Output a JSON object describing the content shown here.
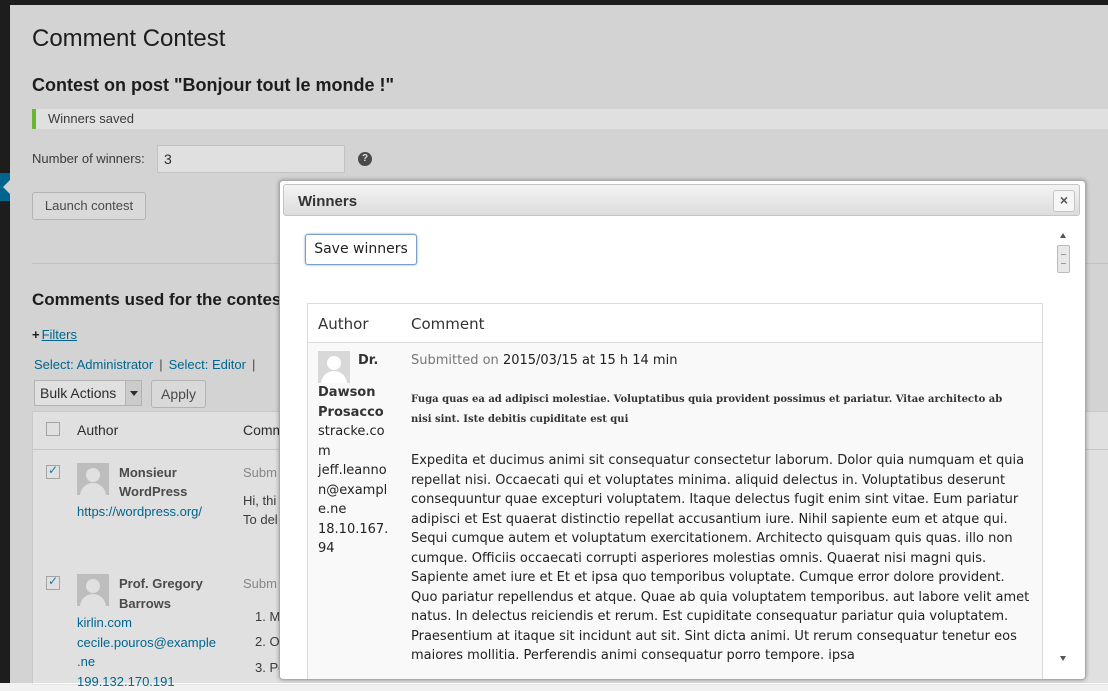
{
  "page": {
    "title": "Comment Contest",
    "subtitle": "Contest on post \"Bonjour tout le monde !\"",
    "notice": "Winners saved",
    "winners_label": "Number of winners:",
    "winners_value": "3",
    "help_icon": "?",
    "launch_button": "Launch contest",
    "comments_heading": "Comments used for the contes",
    "filters_plus": "+",
    "filters_link": "Filters",
    "select_admin": "Select: Administrator",
    "select_editor": "Select: Editor",
    "separator": "|",
    "bulk_actions": "Bulk Actions",
    "apply_button": "Apply"
  },
  "table": {
    "col_author": "Author",
    "col_comment": "Comm",
    "rows": [
      {
        "checked": true,
        "name_line1": "Monsieur",
        "name_line2": "WordPress",
        "url": "https://wordpress.org/",
        "comment_status": "Subm",
        "comment_line1": "Hi, thi",
        "comment_line2": "To del"
      },
      {
        "checked": true,
        "name_line1": "Prof. Gregory",
        "name_line2": "Barrows",
        "url": "kirlin.com",
        "email_line1": "cecile.pouros@example",
        "email_line2": ".ne",
        "ip": "199.132.170.191",
        "comment_status": "Subm",
        "list": [
          "1. M",
          "2. O",
          "3. Po"
        ]
      }
    ]
  },
  "dialog": {
    "title": "Winners",
    "close": "×",
    "save_button": "Save winners",
    "col_author": "Author",
    "col_comment": "Comment",
    "winner": {
      "name_l1": "Dr.",
      "name_l2": "Dawson",
      "name_l3": "Prosacco",
      "site_l1": "stracke.co",
      "site_l2": "m",
      "email_l1": "jeff.leanno",
      "email_l2": "n@exampl",
      "email_l3": "e.ne",
      "ip_l1": "18.10.167.",
      "ip_l2": "94",
      "submitted_label": "Submitted on",
      "submitted_date": "2015/03/15 at 15 h 14 min",
      "title_text": "Fuga quas ea ad adipisci molestiae. Voluptatibus quia provident possimus et pariatur. Vitae architecto ab nisi sint. Iste debitis cupiditate est qui",
      "body_text": "Expedita et ducimus animi sit consequatur consectetur laborum. Dolor quia numquam et quia repellat nisi. Occaecati qui et voluptates minima. aliquid delectus in. Voluptatibus deserunt consequuntur quae excepturi voluptatem. Itaque delectus fugit enim sint vitae. Eum pariatur adipisci et Est quaerat distinctio repellat accusantium iure. Nihil sapiente eum et atque qui. Sequi cumque autem et voluptatum exercitationem. Architecto quisquam quis quas. illo non cumque. Officiis occaecati corrupti asperiores molestias omnis. Quaerat nisi magni quis. Sapiente amet iure et Et et ipsa quo temporibus voluptate. Cumque error dolore provident. Quo pariatur repellendus et atque. Quae ab quia voluptatem temporibus. aut labore velit amet natus. In delectus reiciendis et rerum. Est cupiditate consequatur pariatur quia voluptatem. Praesentium at itaque sit incidunt aut sit. Sint dicta animi. Ut rerum consequatur tenetur eos maiores mollitia. Perferendis animi consequatur porro tempore. ipsa"
    }
  },
  "colors": {
    "accent": "#0074a2",
    "notice_border": "#7ad03a"
  }
}
